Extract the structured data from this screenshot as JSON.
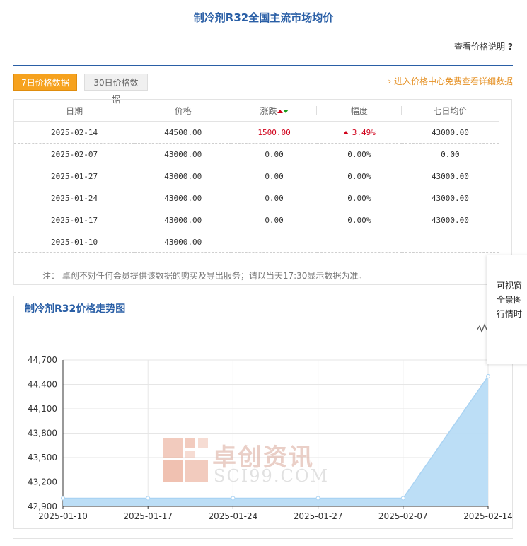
{
  "page": {
    "title": "制冷剂R32全国主流市场均价",
    "price_note": "查看价格说明",
    "price_note_icon": "?",
    "tab_7day": "7日价格数据",
    "tab_30day": "30日价格数据",
    "detail_link": "进入价格中心免费查看详细数据",
    "detail_link_icon": "chevron-right-icon"
  },
  "table": {
    "headers": [
      "日期",
      "价格",
      "涨跌",
      "幅度",
      "七日均价"
    ],
    "rows": [
      {
        "date": "2025-02-14",
        "price": "44500.00",
        "change": "1500.00",
        "pct": "3.49%",
        "avg": "43000.00",
        "trend": "up"
      },
      {
        "date": "2025-02-07",
        "price": "43000.00",
        "change": "0.00",
        "pct": "0.00%",
        "avg": "0.00",
        "trend": "flat"
      },
      {
        "date": "2025-01-27",
        "price": "43000.00",
        "change": "0.00",
        "pct": "0.00%",
        "avg": "43000.00",
        "trend": "flat"
      },
      {
        "date": "2025-01-24",
        "price": "43000.00",
        "change": "0.00",
        "pct": "0.00%",
        "avg": "43000.00",
        "trend": "flat"
      },
      {
        "date": "2025-01-17",
        "price": "43000.00",
        "change": "0.00",
        "pct": "0.00%",
        "avg": "43000.00",
        "trend": "flat"
      },
      {
        "date": "2025-01-10",
        "price": "43000.00",
        "change": "",
        "pct": "",
        "avg": "",
        "trend": "none"
      }
    ],
    "disclaimer": "注：  卓创不对任何会员提供该数据的购买及导出服务；请以当天17:30显示数据为准。"
  },
  "chart": {
    "title": "制冷剂R32价格走势图",
    "watermark": "卓创资讯",
    "watermark_sub": "SCI99.COM"
  },
  "chart_data": {
    "type": "area",
    "x": [
      "2025-01-10",
      "2025-01-17",
      "2025-01-24",
      "2025-01-27",
      "2025-02-07",
      "2025-02-14"
    ],
    "values": [
      43000,
      43000,
      43000,
      43000,
      43000,
      44500
    ],
    "yticks": [
      "42,900",
      "43,200",
      "43,500",
      "43,800",
      "44,100",
      "44,400",
      "44,700"
    ],
    "ylim": [
      42900,
      44700
    ],
    "grid": true,
    "fill_color": "#b8dcf6",
    "line_color": "#a9d3f3"
  },
  "popup": {
    "lines": [
      "可视窗",
      "全景图",
      "行情时"
    ]
  },
  "colors": {
    "brand_blue": "#2a5fa6",
    "accent_orange": "#f6a21e",
    "up_red": "#d0021b",
    "down_green": "#1a9a1a"
  }
}
